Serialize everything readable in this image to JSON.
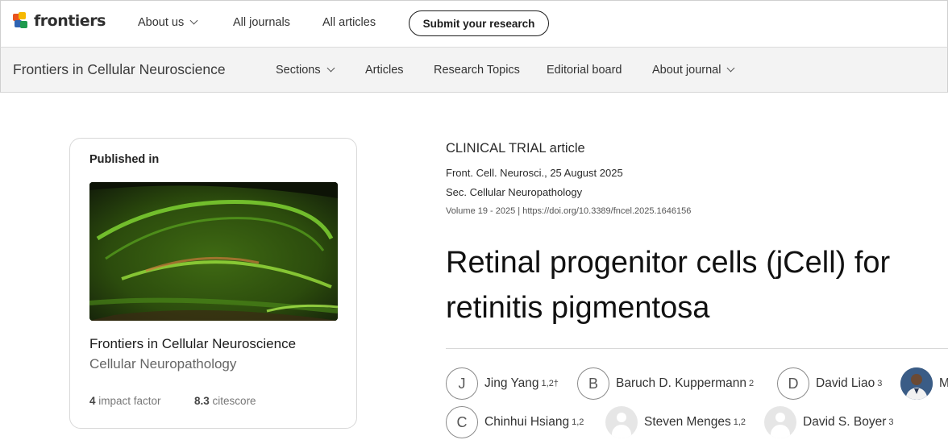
{
  "top_nav": {
    "logo_text": "frontiers",
    "links": [
      "About us",
      "All journals",
      "All articles"
    ],
    "submit_label": "Submit your research"
  },
  "journal_bar": {
    "journal_name": "Frontiers in Cellular Neuroscience",
    "links": [
      "Sections",
      "Articles",
      "Research Topics",
      "Editorial board",
      "About journal"
    ]
  },
  "published_card": {
    "label": "Published in",
    "journal": "Frontiers in Cellular Neuroscience",
    "section": "Cellular Neuropathology",
    "impact_factor_value": "4",
    "impact_factor_label": "impact factor",
    "citescore_value": "8.3",
    "citescore_label": "citescore"
  },
  "article": {
    "type": "CLINICAL TRIAL article",
    "citation": "Front. Cell. Neurosci., 25 August 2025",
    "section": "Sec. Cellular Neuropathology",
    "volume_doi": "Volume 19 - 2025 | https://doi.org/10.3389/fncel.2025.1646156",
    "title_line1": "Retinal progenitor cells (jCell) for",
    "title_line2": "retinitis pigmentosa"
  },
  "authors": [
    {
      "initial": "J",
      "name": "Jing Yang",
      "affil": "1,2†"
    },
    {
      "initial": "B",
      "name": "Baruch D. Kuppermann",
      "affil": "2"
    },
    {
      "initial": "D",
      "name": "David Liao",
      "affil": "3"
    },
    {
      "initial": "",
      "name": "M",
      "affil": ""
    },
    {
      "initial": "C",
      "name": "Chinhui Hsiang",
      "affil": "1,2"
    },
    {
      "initial": "",
      "name": "Steven Menges",
      "affil": "1,2"
    },
    {
      "initial": "",
      "name": "David S. Boyer",
      "affil": "3"
    }
  ],
  "colors": {
    "brand_orange": "#e9541e",
    "brand_yellow": "#f6b800",
    "brand_blue": "#2e64b2",
    "brand_green": "#1e9a4d",
    "journal_bar_bg": "#f3f3f3"
  }
}
